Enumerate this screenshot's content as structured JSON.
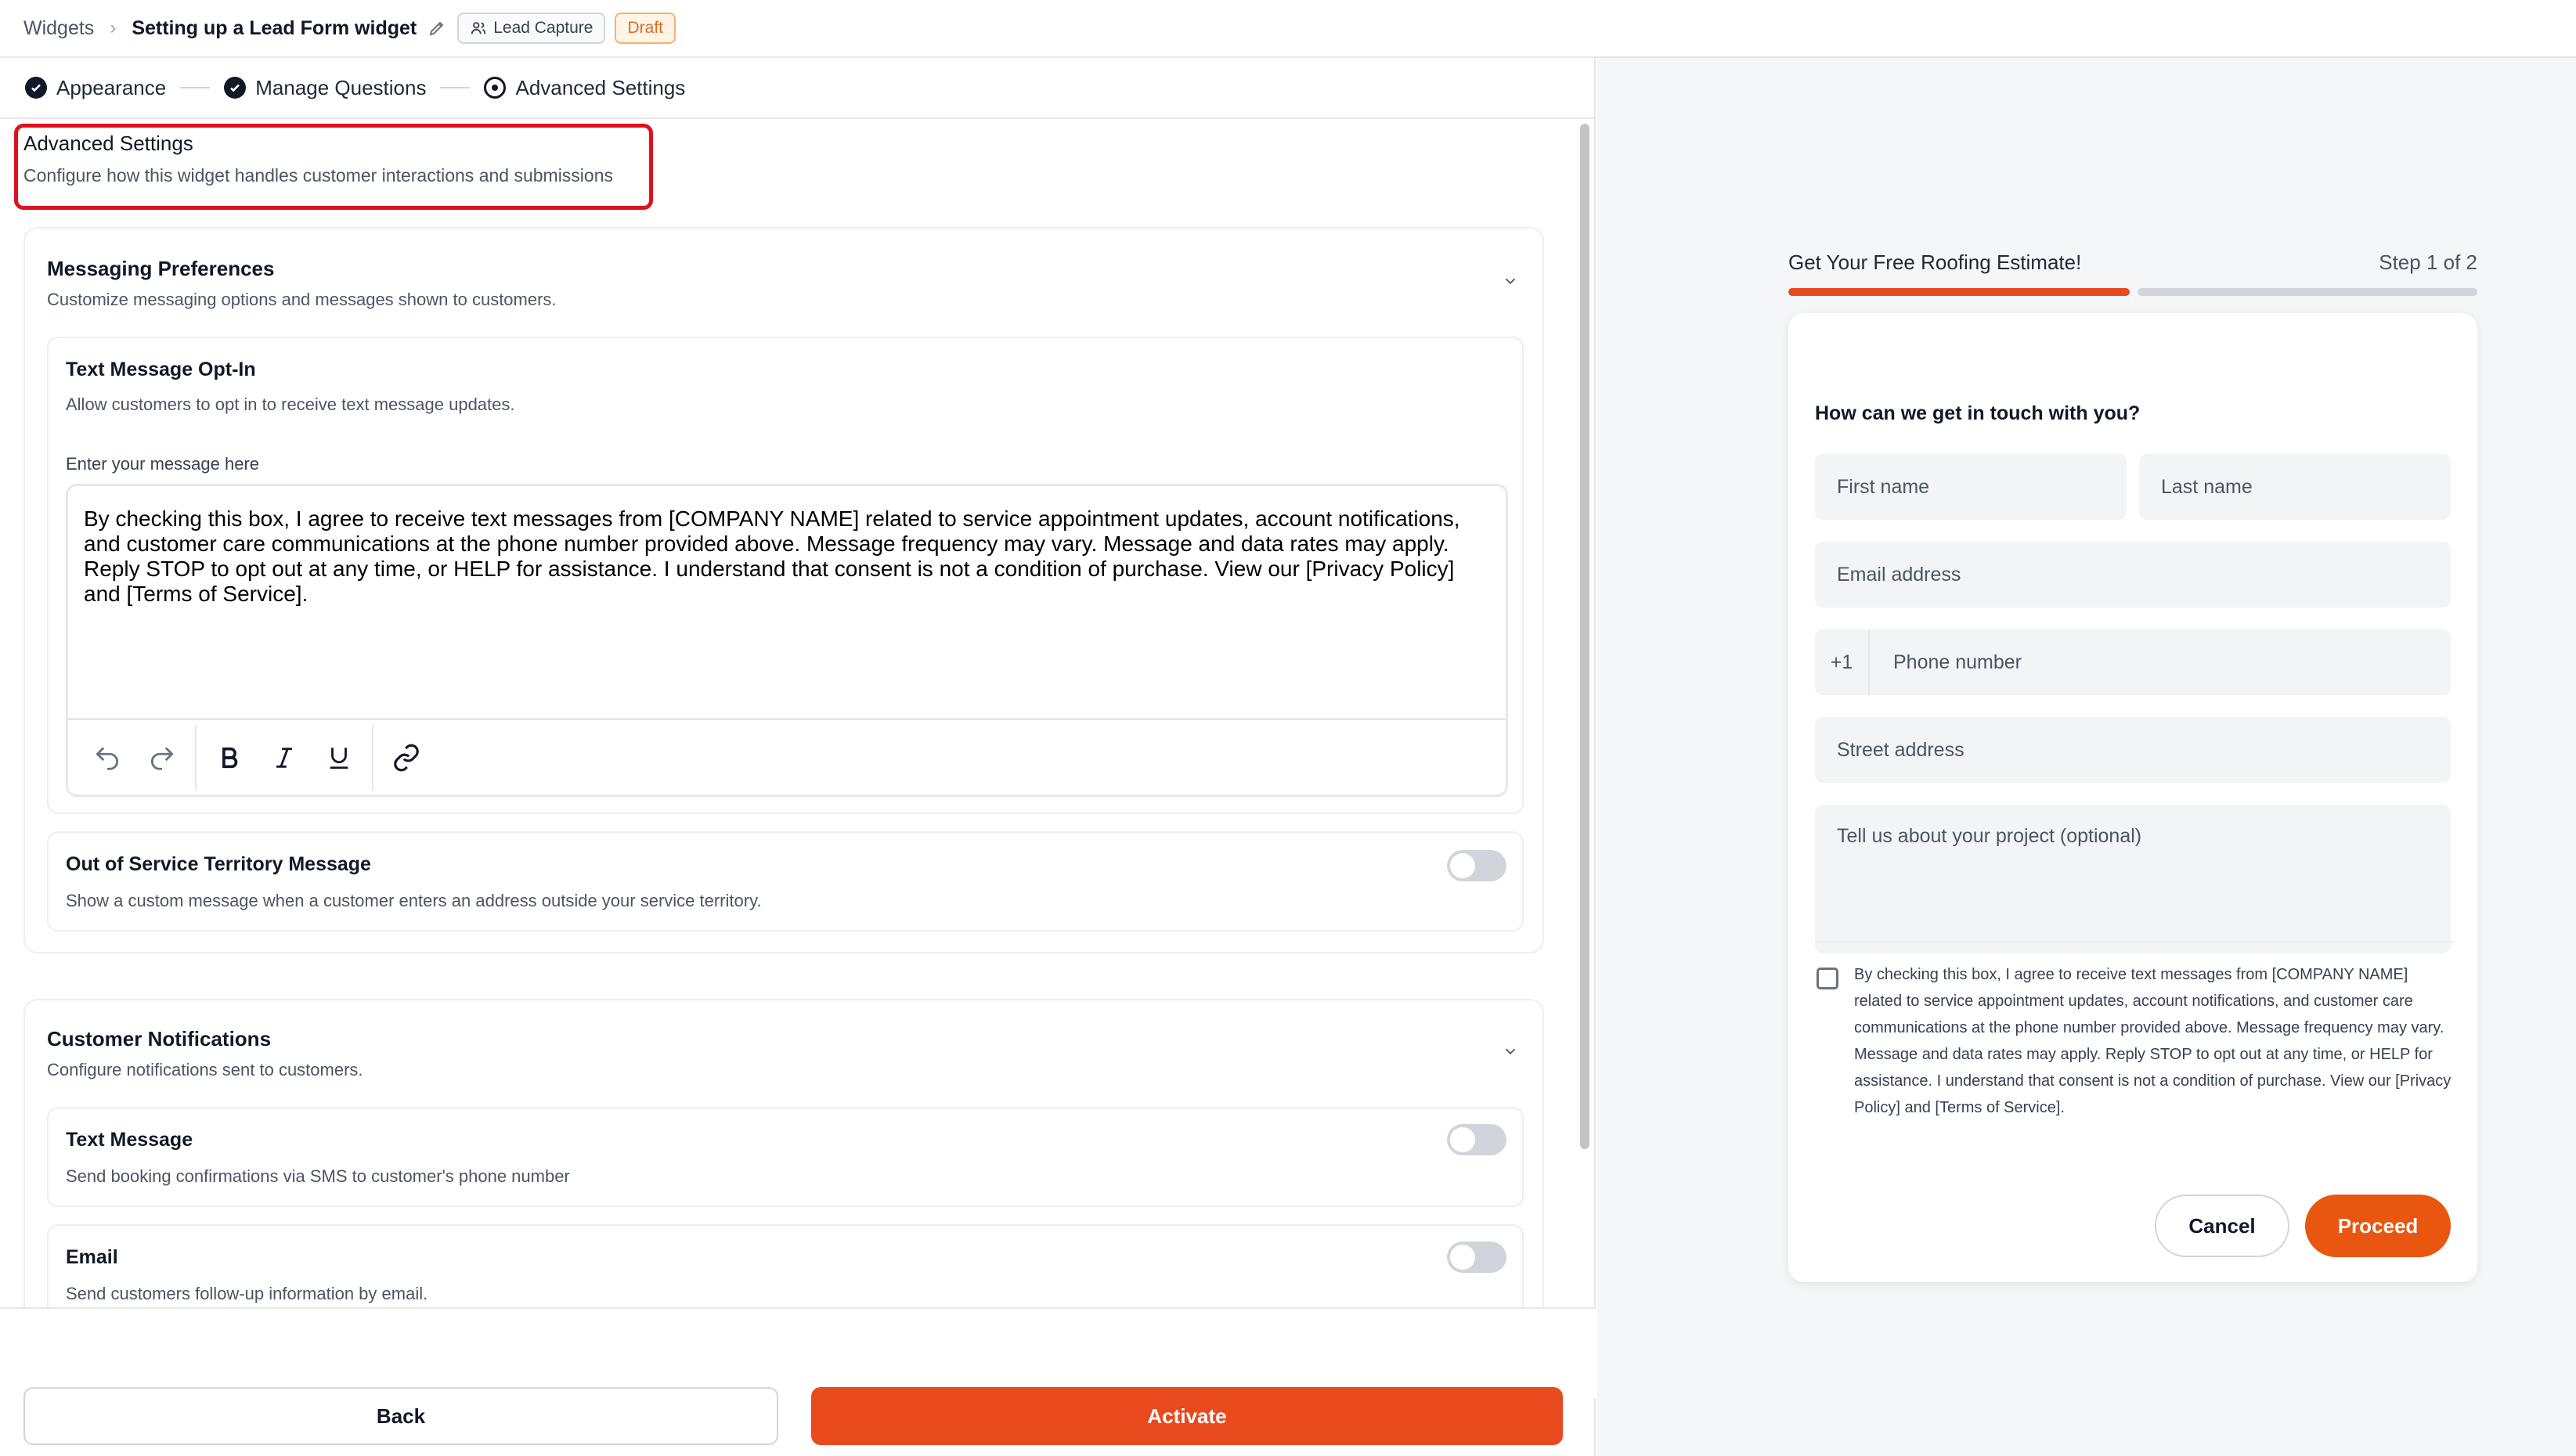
{
  "breadcrumb": {
    "root": "Widgets",
    "separator": "›",
    "title": "Setting up a Lead Form widget",
    "badge_type": "Lead Capture",
    "badge_status": "Draft"
  },
  "stepper": {
    "steps": [
      {
        "label": "Appearance",
        "state": "complete"
      },
      {
        "label": "Manage Questions",
        "state": "complete"
      },
      {
        "label": "Advanced Settings",
        "state": "current"
      }
    ]
  },
  "advanced": {
    "title": "Advanced Settings",
    "subtitle": "Configure how this widget handles customer interactions and submissions"
  },
  "messaging": {
    "title": "Messaging Preferences",
    "subtitle": "Customize messaging options and messages shown to customers.",
    "opt_in": {
      "title": "Text Message Opt-In",
      "subtitle": "Allow customers to opt in to receive text message updates.",
      "editor_label": "Enter your message here",
      "editor_text": "By checking this box, I agree to receive text messages from [COMPANY NAME] related to service appointment updates, account notifications, and customer care communications at the phone number provided above. Message frequency may vary. Message and data rates may apply. Reply STOP to opt out at any time, or HELP for assistance. I understand that consent is not a condition of purchase. View our [Privacy Policy] and [Terms of Service]."
    },
    "out_of_service": {
      "title": "Out of Service Territory Message",
      "subtitle": "Show a custom message when a customer enters an address outside your service territory.",
      "enabled": false
    }
  },
  "notifications": {
    "title": "Customer Notifications",
    "subtitle": "Configure notifications sent to customers.",
    "text_message": {
      "title": "Text Message",
      "subtitle": "Send booking confirmations via SMS to customer's phone number",
      "enabled": false
    },
    "email": {
      "title": "Email",
      "subtitle": "Send customers follow-up information by email.",
      "enabled": false
    }
  },
  "footer": {
    "back_label": "Back",
    "activate_label": "Activate"
  },
  "preview": {
    "title": "Get Your Free Roofing Estimate!",
    "step_label": "Step 1 of 2",
    "progress": 0.5,
    "question": "How can we get in touch with you?",
    "first_name": "First name",
    "last_name": "Last name",
    "email": "Email address",
    "phone_prefix": "+1",
    "phone": "Phone number",
    "street": "Street address",
    "project": "Tell us about your project (optional)",
    "consent_text": "By checking this box, I agree to receive text messages from [COMPANY NAME] related to service appointment updates, account notifications, and customer care communications at the phone number provided above. Message frequency may vary. Message and data rates may apply. Reply STOP to opt out at any time, or HELP for assistance. I understand that consent is not a condition of purchase. View our [Privacy Policy] and [Terms of Service].",
    "cancel_label": "Cancel",
    "proceed_label": "Proceed"
  },
  "colors": {
    "accent": "#e8491d",
    "highlight_box": "#e0101c",
    "draft_badge": "#dd6b20"
  }
}
